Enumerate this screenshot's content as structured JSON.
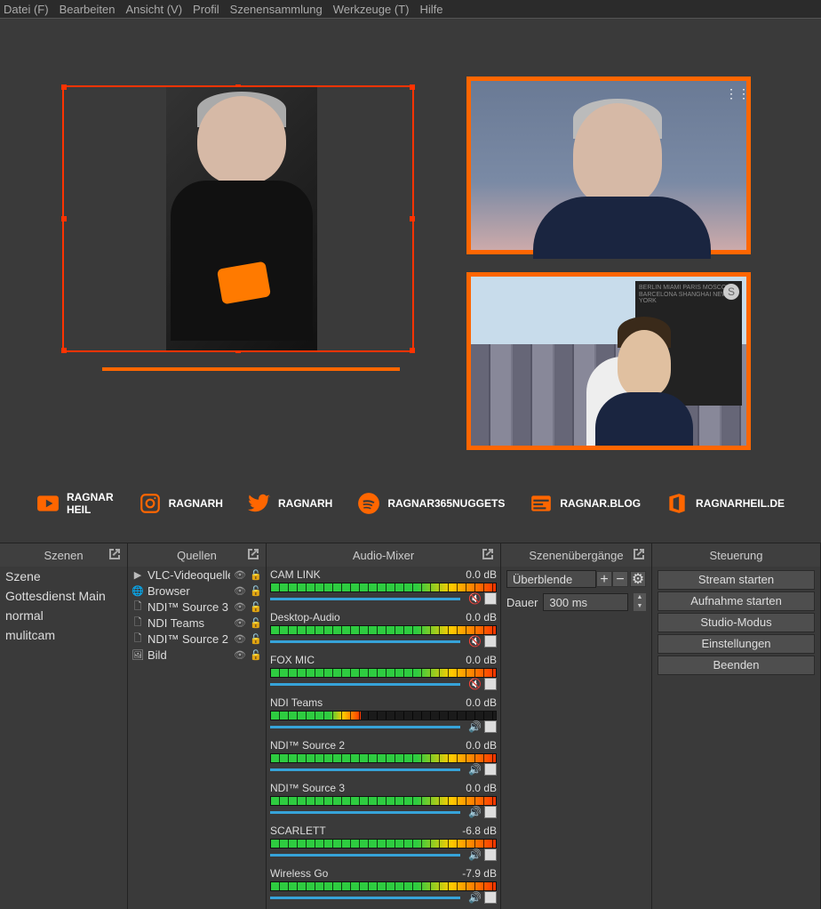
{
  "menu": [
    "Datei (F)",
    "Bearbeiten",
    "Ansicht (V)",
    "Profil",
    "Szenensammlung",
    "Werkzeuge (T)",
    "Hilfe"
  ],
  "social": [
    {
      "icon": "youtube",
      "label": "RAGNAR HEIL"
    },
    {
      "icon": "instagram",
      "label": "RAGNARH"
    },
    {
      "icon": "twitter",
      "label": "RAGNARH"
    },
    {
      "icon": "spotify",
      "label": "RAGNAR365NUGGETS"
    },
    {
      "icon": "blog",
      "label": "RAGNAR.BLOG"
    },
    {
      "icon": "office",
      "label": "RAGNARHEIL.DE"
    }
  ],
  "docks": {
    "scenes_title": "Szenen",
    "sources_title": "Quellen",
    "mixer_title": "Audio-Mixer",
    "trans_title": "Szenenübergänge",
    "ctrls_title": "Steuerung"
  },
  "scenes": [
    "Szene",
    "Gottesdienst Main",
    "normal",
    "mulitcam"
  ],
  "sources": [
    {
      "ico": "▶",
      "name": "VLC-Videoquelle",
      "vis": true,
      "lock": false
    },
    {
      "ico": "🌐",
      "name": "Browser",
      "vis": true,
      "lock": false
    },
    {
      "ico": "🗋",
      "name": "NDI™ Source 3",
      "vis": true,
      "lock": false
    },
    {
      "ico": "🗋",
      "name": "NDI Teams",
      "vis": true,
      "lock": false
    },
    {
      "ico": "🗋",
      "name": "NDI™ Source 2",
      "vis": true,
      "lock": false
    },
    {
      "ico": "🖼",
      "name": "Bild",
      "vis": true,
      "lock": false
    }
  ],
  "mixer": [
    {
      "name": "CAM LINK",
      "db": "0.0 dB",
      "level": 100,
      "muted": true,
      "slider": 85
    },
    {
      "name": "Desktop-Audio",
      "db": "0.0 dB",
      "level": 100,
      "muted": true,
      "slider": 85
    },
    {
      "name": "FOX MIC",
      "db": "0.0 dB",
      "level": 100,
      "muted": true,
      "slider": 85
    },
    {
      "name": "NDI Teams",
      "db": "0.0 dB",
      "level": 40,
      "muted": false,
      "slider": 85
    },
    {
      "name": "NDI™ Source 2",
      "db": "0.0 dB",
      "level": 100,
      "muted": false,
      "slider": 85
    },
    {
      "name": "NDI™ Source 3",
      "db": "0.0 dB",
      "level": 100,
      "muted": false,
      "slider": 85
    },
    {
      "name": "SCARLETT",
      "db": "-6.8 dB",
      "level": 100,
      "muted": false,
      "slider": 70
    },
    {
      "name": "Wireless Go",
      "db": "-7.9 dB",
      "level": 100,
      "muted": false,
      "slider": 68
    }
  ],
  "transitions": {
    "selected": "Überblende",
    "duration_label": "Dauer",
    "duration_value": "300 ms"
  },
  "controls": [
    "Stream starten",
    "Aufnahme starten",
    "Studio-Modus",
    "Einstellungen",
    "Beenden"
  ]
}
